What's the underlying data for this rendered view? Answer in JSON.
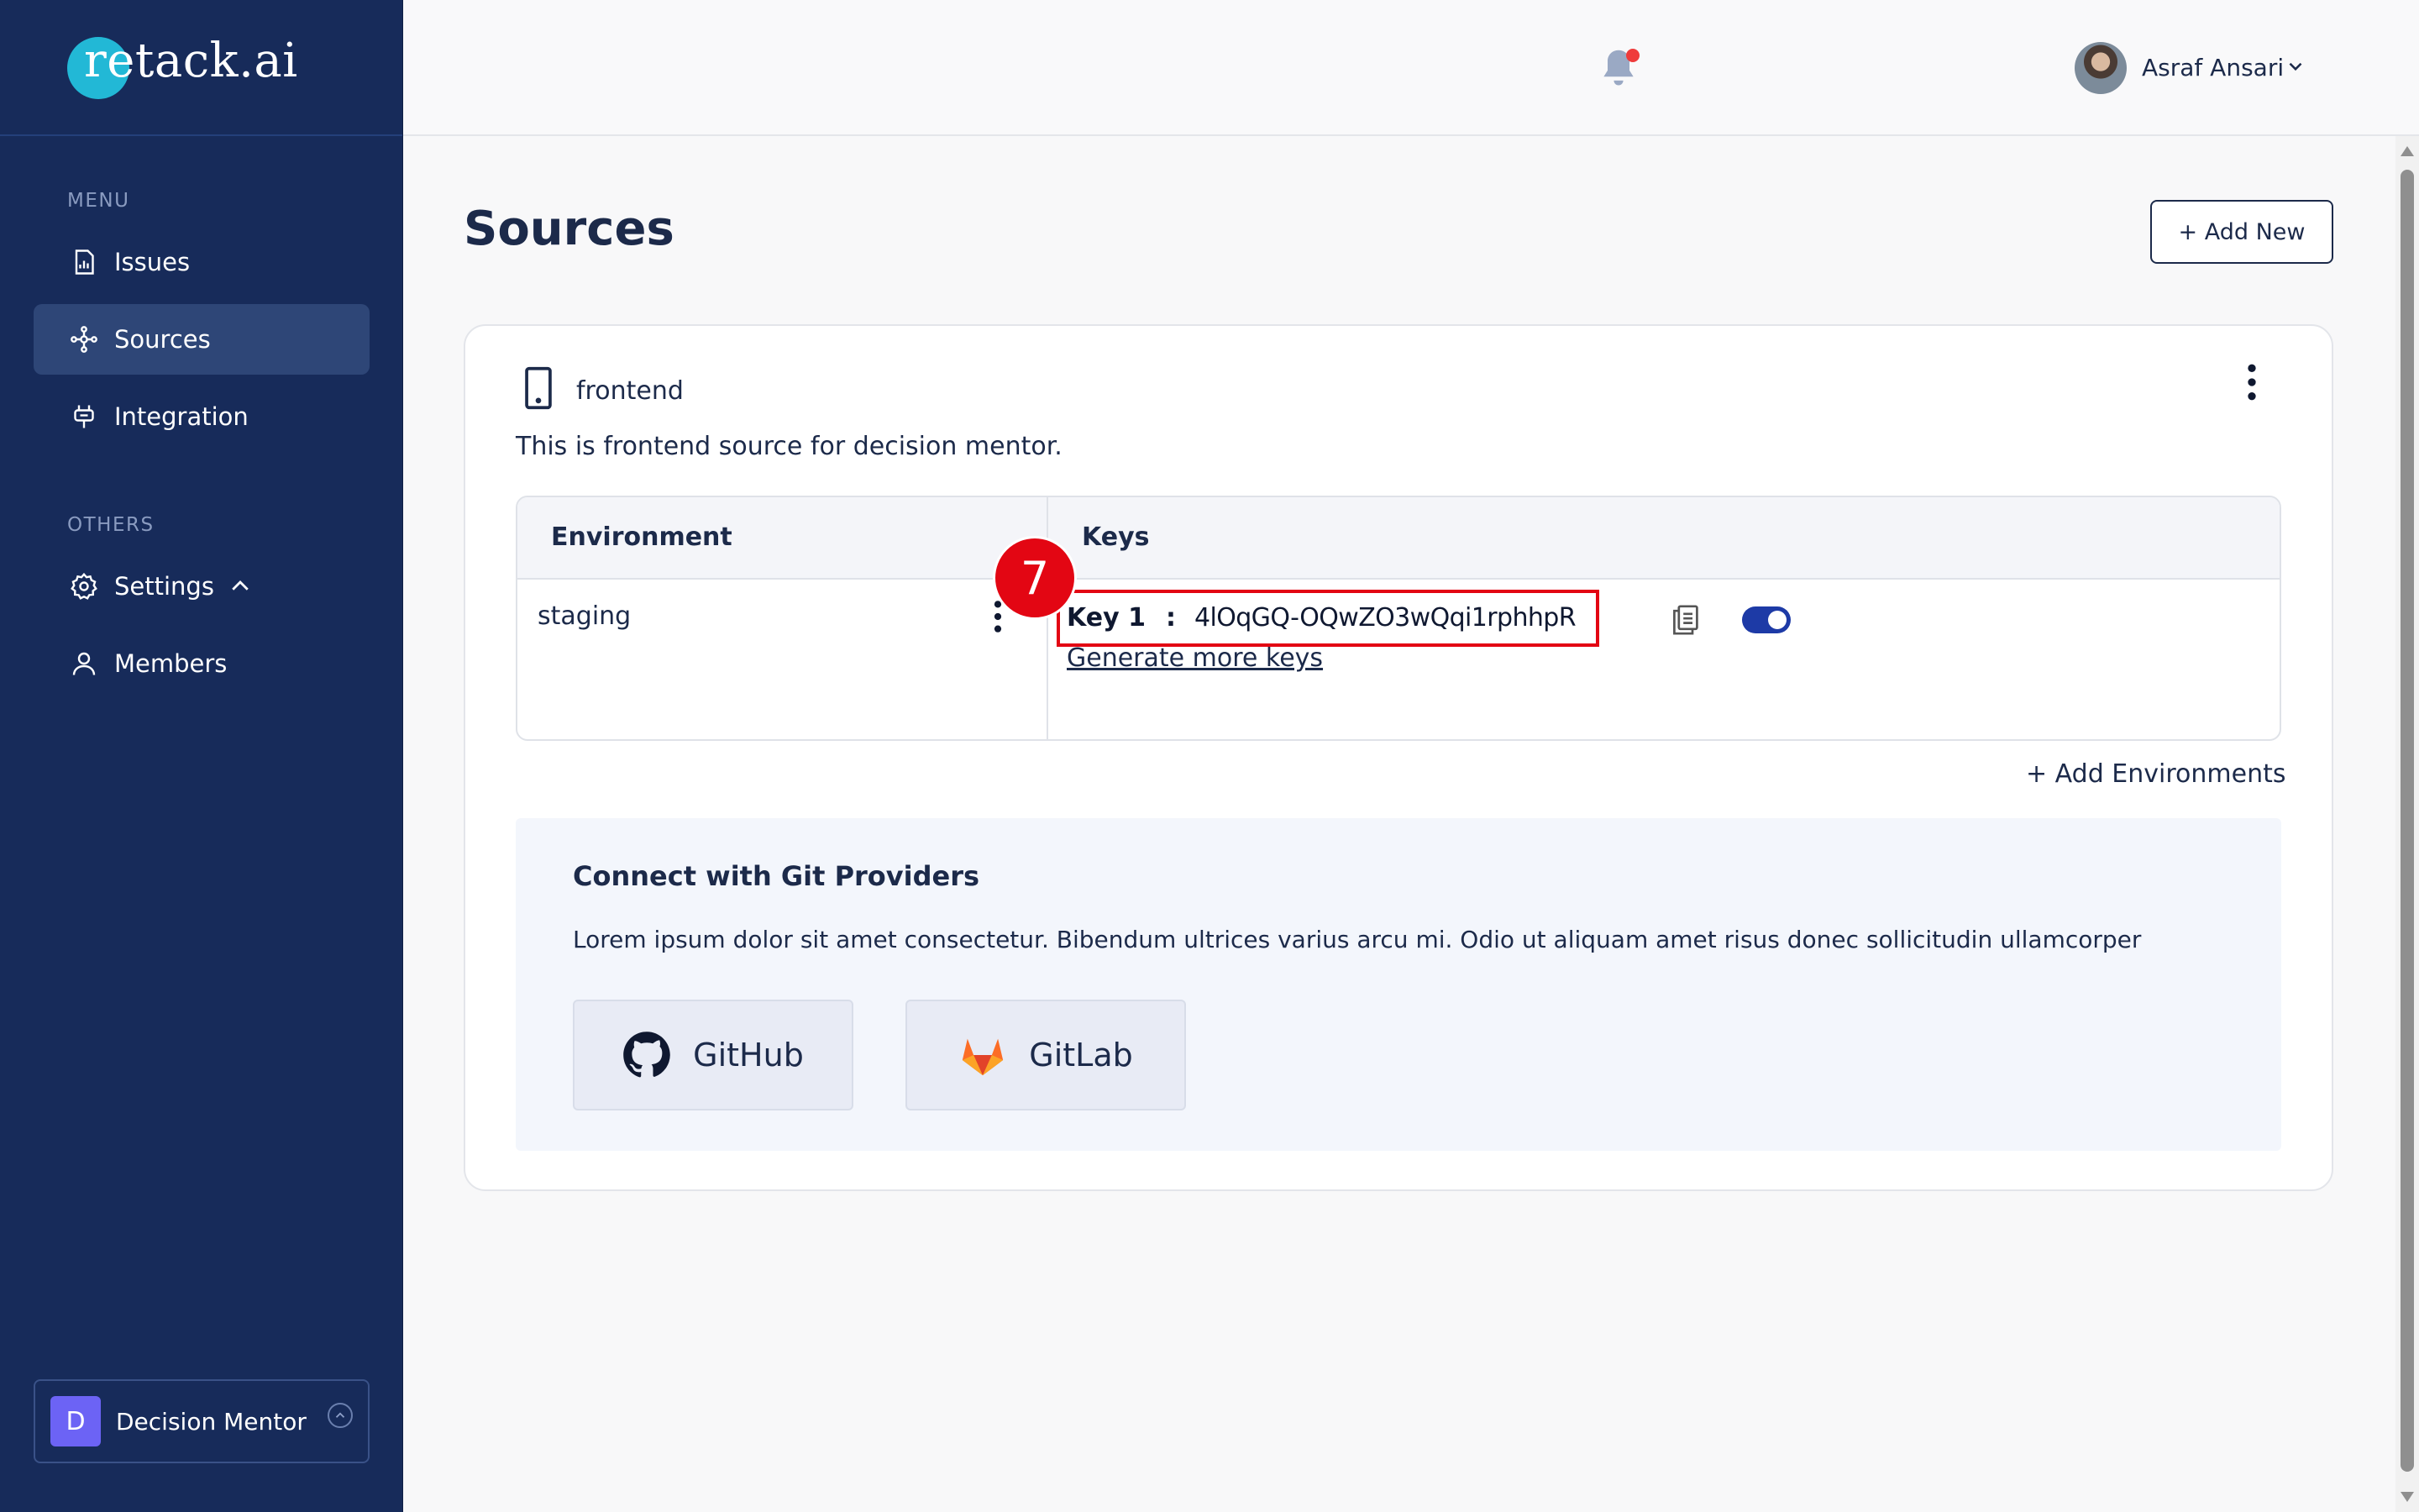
{
  "brand": {
    "logo_prefix": "re",
    "logo_text": "retack.ai"
  },
  "sidebar": {
    "menu_label": "MENU",
    "menu_items": [
      {
        "label": "Issues",
        "icon": "report-icon",
        "active": false
      },
      {
        "label": "Sources",
        "icon": "nodes-icon",
        "active": true
      },
      {
        "label": "Integration",
        "icon": "plug-icon",
        "active": false
      }
    ],
    "others_label": "OTHERS",
    "others_items": [
      {
        "label": "Settings",
        "icon": "gear-icon",
        "expanded": true
      },
      {
        "label": "Members",
        "icon": "user-icon"
      }
    ],
    "workspace": {
      "initial": "D",
      "name": "Decision Mentor"
    }
  },
  "topbar": {
    "notification_icon": "bell-icon",
    "user_name": "Asraf Ansari"
  },
  "page": {
    "title": "Sources",
    "add_new_label": "+ Add New"
  },
  "source": {
    "icon": "mobile-device-icon",
    "name": "frontend",
    "description": "This is frontend source for decision mentor.",
    "table": {
      "headers": [
        "Environment",
        "Keys"
      ],
      "rows": [
        {
          "environment": "staging",
          "key_label": "Key 1",
          "key_separator": ":",
          "key_value": "4lOqGQ-OQwZO3wQqi1rphhpR",
          "enabled": true
        }
      ],
      "generate_more_keys": "Generate more keys"
    },
    "add_environments_label": "+ Add Environments"
  },
  "annotation": {
    "step_number": "7"
  },
  "git": {
    "title": "Connect with Git Providers",
    "description": "Lorem ipsum dolor sit amet consectetur. Bibendum ultrices varius arcu mi. Odio ut aliquam amet risus donec sollicitudin ullamcorper",
    "providers": [
      {
        "label": "GitHub",
        "icon": "github-icon"
      },
      {
        "label": "GitLab",
        "icon": "gitlab-icon"
      }
    ]
  },
  "colors": {
    "sidebar_bg": "#172b5a",
    "accent_teal": "#22b8d6",
    "annotation_red": "#e30613",
    "toggle_blue": "#1d3aa6",
    "workspace_avatar": "#6c63f5"
  }
}
